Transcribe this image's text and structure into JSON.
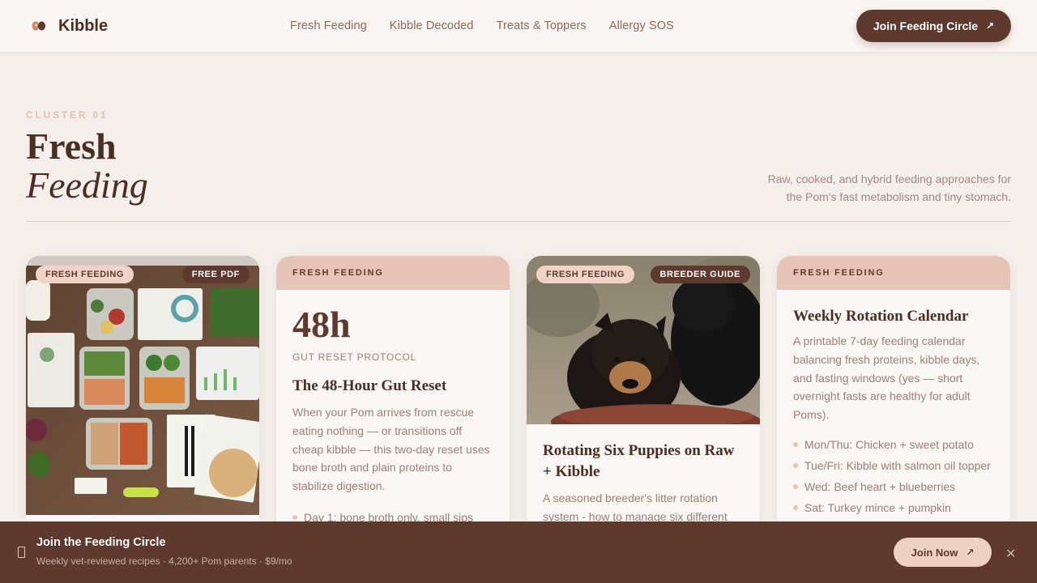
{
  "header": {
    "brand": "Kibble",
    "nav": [
      "Fresh Feeding",
      "Kibble Decoded",
      "Treats & Toppers",
      "Allergy SOS"
    ],
    "cta_label": "Join Feeding Circle",
    "cta_arrow": "↗"
  },
  "hero": {
    "eyebrow": "CLUSTER 01",
    "title_line1": "Fresh",
    "title_line2": "Feeding",
    "description": "Raw, cooked, and hybrid feeding approaches for the Pom's fast metabolism and tiny stomach."
  },
  "cards": [
    {
      "tag": "FRESH FEEDING",
      "badge": "FREE PDF"
    },
    {
      "tag": "FRESH FEEDING",
      "big": "48h",
      "sublabel": "GUT RESET PROTOCOL",
      "title": "The 48-Hour Gut Reset",
      "text": "When your Pom arrives from rescue eating nothing — or transitions off cheap kibble — this two-day reset uses bone broth and plain proteins to stabilize digestion.",
      "list": [
        "Day 1: bone broth only, small sips"
      ]
    },
    {
      "tag": "FRESH FEEDING",
      "badge": "BREEDER GUIDE",
      "title": "Rotating Six Puppies on Raw + Kibble",
      "text": "A seasoned breeder's litter rotation system - how to manage six different"
    },
    {
      "tag": "FRESH FEEDING",
      "title": "Weekly Rotation Calendar",
      "text": "A printable 7-day feeding calendar balancing fresh proteins, kibble days, and fasting windows (yes — short overnight fasts are healthy for adult Poms).",
      "list": [
        "Mon/Thu: Chicken + sweet potato",
        "Tue/Fri: Kibble with salmon oil topper",
        "Wed: Beef heart + blueberries",
        "Sat: Turkey mince + pumpkin"
      ]
    }
  ],
  "bottom_bar": {
    "title": "Join the Feeding Circle",
    "subtitle": "Weekly vet-reviewed recipes · 4,200+ Pom parents · $9/mo",
    "button": "Join Now",
    "button_arrow": "↗",
    "close": "✕"
  }
}
